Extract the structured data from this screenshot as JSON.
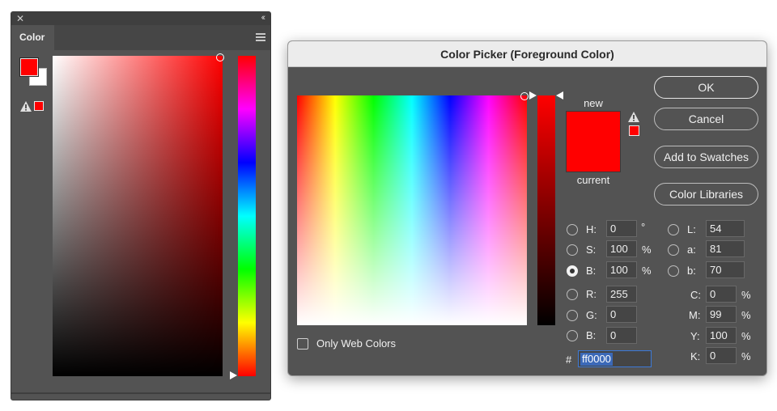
{
  "color_panel": {
    "tab_label": "Color",
    "close_glyph": "✕",
    "collapse_glyph": "‹‹",
    "foreground_color": "#ff0000",
    "background_color": "#ffffff",
    "gamut_warning_color": "#ff0000",
    "icons": [
      "close-icon",
      "collapse-icon",
      "panel-menu-icon",
      "warning-icon",
      "hue-slider-arrow-icon"
    ]
  },
  "dialog": {
    "title": "Color Picker (Foreground Color)",
    "buttons": {
      "ok": "OK",
      "cancel": "Cancel",
      "add_to_swatches": "Add to Swatches",
      "color_libraries": "Color Libraries"
    },
    "preview": {
      "new_label": "new",
      "current_label": "current",
      "new_color": "#ff0000",
      "current_color": "#ff0000"
    },
    "gamut_warning_color": "#ff0000",
    "only_web_colors": {
      "label": "Only Web Colors",
      "checked": false
    },
    "hsb": {
      "h": {
        "label": "H:",
        "value": "0",
        "unit": "°"
      },
      "s": {
        "label": "S:",
        "value": "100",
        "unit": "%"
      },
      "b": {
        "label": "B:",
        "value": "100",
        "unit": "%",
        "selected": true
      }
    },
    "rgb": {
      "r": {
        "label": "R:",
        "value": "255"
      },
      "g": {
        "label": "G:",
        "value": "0"
      },
      "b": {
        "label": "B:",
        "value": "0"
      }
    },
    "lab": {
      "l": {
        "label": "L:",
        "value": "54"
      },
      "a": {
        "label": "a:",
        "value": "81"
      },
      "b": {
        "label": "b:",
        "value": "70"
      }
    },
    "cmyk": {
      "c": {
        "label": "C:",
        "value": "0",
        "unit": "%"
      },
      "m": {
        "label": "M:",
        "value": "99",
        "unit": "%"
      },
      "y": {
        "label": "Y:",
        "value": "100",
        "unit": "%"
      },
      "k": {
        "label": "K:",
        "value": "0",
        "unit": "%"
      }
    },
    "hex": {
      "label": "#",
      "value": "ff0000"
    }
  }
}
